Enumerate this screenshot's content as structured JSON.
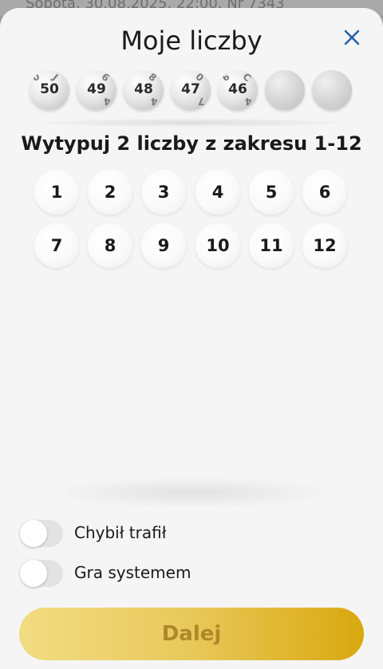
{
  "background_text": "Sobota, 30.08.2025, 22:00, Nr 7343",
  "header": {
    "title": "Moje liczby",
    "close_icon": "close-icon"
  },
  "picked_balls": [
    {
      "number": "50",
      "filled": true
    },
    {
      "number": "49",
      "filled": true
    },
    {
      "number": "48",
      "filled": true
    },
    {
      "number": "47",
      "filled": true
    },
    {
      "number": "46",
      "filled": true
    },
    {
      "number": "",
      "filled": false
    },
    {
      "number": "",
      "filled": false
    }
  ],
  "instruction": "Wytypuj 2 liczby z zakresu 1-12",
  "number_choices": [
    "1",
    "2",
    "3",
    "4",
    "5",
    "6",
    "7",
    "8",
    "9",
    "10",
    "11",
    "12"
  ],
  "toggles": [
    {
      "label": "Chybił trafił",
      "on": false
    },
    {
      "label": "Gra systemem",
      "on": false
    }
  ],
  "cta": {
    "label": "Dalej",
    "enabled": false
  },
  "colors": {
    "accent_gold": "#d9a80e",
    "close_blue": "#1f5fa8"
  }
}
